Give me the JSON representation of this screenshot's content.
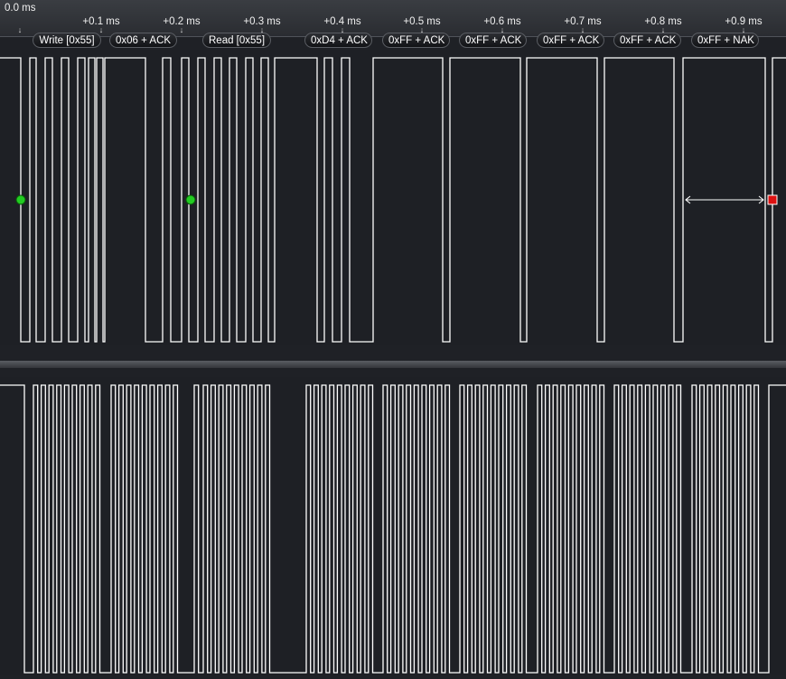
{
  "ruler": {
    "origin_label": "0.0 ms",
    "ticks": [
      "+0.1 ms",
      "+0.2 ms",
      "+0.3 ms",
      "+0.4 ms",
      "+0.5 ms",
      "+0.6 ms",
      "+0.7 ms",
      "+0.8 ms",
      "+0.9 ms"
    ]
  },
  "decoded_packets": [
    {
      "label": "Write [0x55]"
    },
    {
      "label": "0x06 + ACK"
    },
    {
      "label": "Read [0x55]"
    },
    {
      "label": "0xD4 + ACK"
    },
    {
      "label": "0xFF + ACK"
    },
    {
      "label": "0xFF + ACK"
    },
    {
      "label": "0xFF + ACK"
    },
    {
      "label": "0xFF + ACK"
    },
    {
      "label": "0xFF + NAK"
    }
  ],
  "markers": {
    "start_color": "#22cc22",
    "stop_color": "#dd1111"
  },
  "colors": {
    "waveform": "#ffffff",
    "background": "#1f2126"
  }
}
